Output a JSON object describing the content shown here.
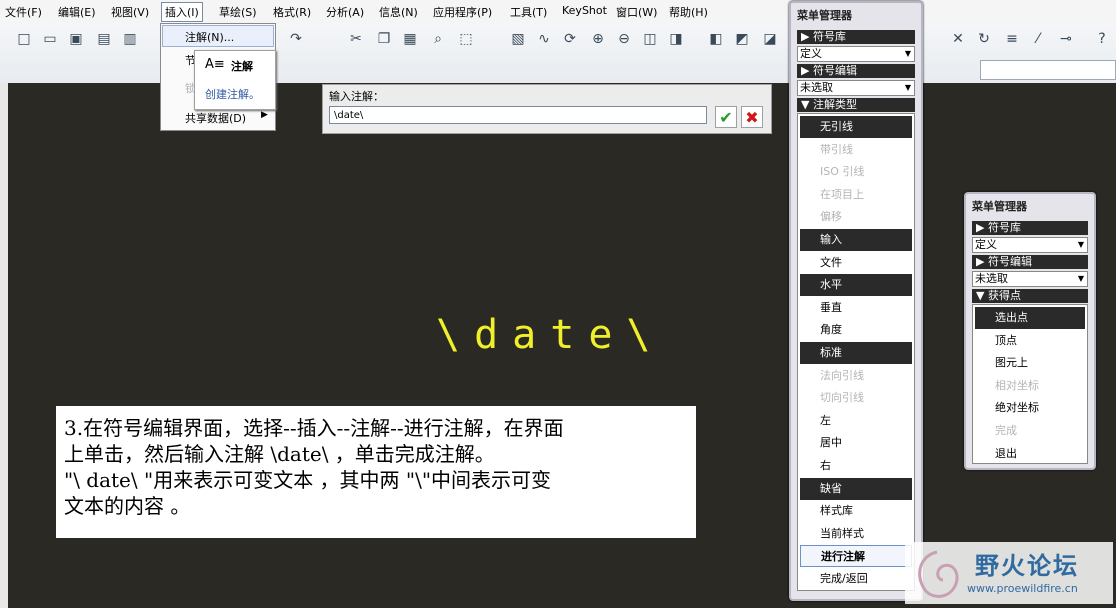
{
  "menubar": {
    "items": [
      "文件(F)",
      "编辑(E)",
      "视图(V)",
      "插入(I)",
      "草绘(S)",
      "格式(R)",
      "分析(A)",
      "信息(N)",
      "应用程序(P)",
      "工具(T)",
      "KeyShot",
      "窗口(W)",
      "帮助(H)"
    ]
  },
  "insert_menu": {
    "items": [
      "注解(N)...",
      "节",
      "锁",
      "共享数据(D)"
    ]
  },
  "submenu": {
    "title": "注解",
    "item": "创建注解。"
  },
  "annot_panel": {
    "label": "输入注解：",
    "value": "\\date\\"
  },
  "canvas": {
    "note_text": "\\date\\"
  },
  "menu_manager_1": {
    "title": "菜单管理器",
    "sym_lib": "▶ 符号库",
    "sym_lib_value": "定义",
    "sym_edit": "▶ 符号编辑",
    "sym_edit_value": "未选取",
    "note_type": "▼ 注解类型",
    "items": [
      {
        "label": "无引线",
        "style": "dark"
      },
      {
        "label": "带引线",
        "style": "dis"
      },
      {
        "label": "ISO 引线",
        "style": "dis"
      },
      {
        "label": "在项目上",
        "style": "dis"
      },
      {
        "label": "偏移",
        "style": "dis"
      },
      {
        "label": "输入",
        "style": "dark"
      },
      {
        "label": "文件",
        "style": "normal"
      },
      {
        "label": "水平",
        "style": "dark"
      },
      {
        "label": "垂直",
        "style": "normal"
      },
      {
        "label": "角度",
        "style": "normal"
      },
      {
        "label": "标准",
        "style": "dark"
      },
      {
        "label": "法向引线",
        "style": "dis"
      },
      {
        "label": "切向引线",
        "style": "dis"
      },
      {
        "label": "左",
        "style": "normal"
      },
      {
        "label": "居中",
        "style": "normal"
      },
      {
        "label": "右",
        "style": "normal"
      },
      {
        "label": "缺省",
        "style": "dark"
      },
      {
        "label": "样式库",
        "style": "normal"
      },
      {
        "label": "当前样式",
        "style": "normal"
      },
      {
        "label": "进行注解",
        "style": "hl"
      },
      {
        "label": "完成/返回",
        "style": "normal"
      }
    ]
  },
  "menu_manager_2": {
    "title": "菜单管理器",
    "sym_lib": "▶ 符号库",
    "sym_lib_value": "定义",
    "sym_edit": "▶ 符号编辑",
    "sym_edit_value": "未选取",
    "get_point": "▼ 获得点",
    "items": [
      {
        "label": "选出点",
        "style": "dark"
      },
      {
        "label": "顶点",
        "style": "normal"
      },
      {
        "label": "图元上",
        "style": "normal"
      },
      {
        "label": "相对坐标",
        "style": "dis"
      },
      {
        "label": "绝对坐标",
        "style": "normal"
      },
      {
        "label": "完成",
        "style": "dis"
      },
      {
        "label": "退出",
        "style": "normal"
      }
    ]
  },
  "caption": {
    "line1": "3.在符号编辑界面，选择--插入--注解--进行注解，在界面",
    "line2": "上单击，然后输入注解 \\date\\ ，单击完成注解。",
    "line3": " \"\\ date\\ \"用来表示可变文本 ，其中两 \"\\\"中间表示可变",
    "line4": "文本的内容 。"
  },
  "watermark": {
    "title": "野火论坛",
    "url": "www.proewildfire.cn"
  },
  "colors": {
    "canvas_bg": "#2b2924",
    "note_text": "#f0f02a",
    "dark_button": "#2a2a2a"
  }
}
